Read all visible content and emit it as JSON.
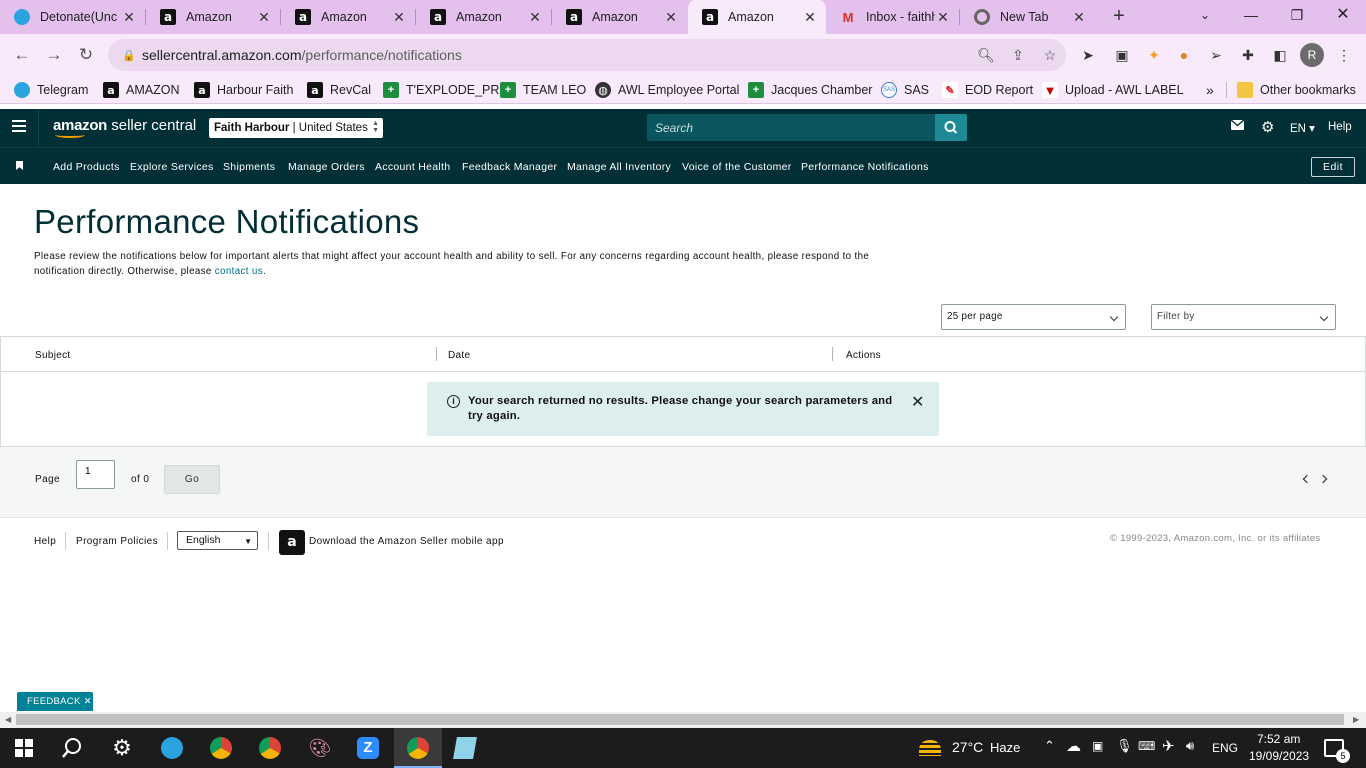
{
  "browser": {
    "tabs": [
      {
        "title": "Detonate(Unc",
        "icon": "telegram-icon"
      },
      {
        "title": "Amazon",
        "icon": "amazon-icon"
      },
      {
        "title": "Amazon",
        "icon": "amazon-icon"
      },
      {
        "title": "Amazon",
        "icon": "amazon-icon"
      },
      {
        "title": "Amazon",
        "icon": "amazon-icon"
      },
      {
        "title": "Amazon",
        "icon": "amazon-icon",
        "active": true
      },
      {
        "title": "Inbox - faithh",
        "icon": "gmail-icon"
      },
      {
        "title": "New Tab",
        "icon": "chrome-icon"
      }
    ],
    "url_domain": "sellercentral.amazon.com",
    "url_path": "/performance/notifications",
    "profile_initial": "R",
    "bookmarks": [
      {
        "label": "Telegram",
        "icon": "telegram-icon"
      },
      {
        "label": "AMAZON",
        "icon": "amazon-icon"
      },
      {
        "label": "Harbour Faith",
        "icon": "amazon-icon"
      },
      {
        "label": "RevCal",
        "icon": "amazon-icon"
      },
      {
        "label": "T'EXPLODE_PR",
        "icon": "plus-icon"
      },
      {
        "label": "TEAM LEO",
        "icon": "plus-icon"
      },
      {
        "label": "AWL Employee Portal",
        "icon": "globe-icon"
      },
      {
        "label": "Jacques Chamber",
        "icon": "plus-icon"
      },
      {
        "label": "SAS",
        "icon": "sas-icon"
      },
      {
        "label": "EOD Report",
        "icon": "eod-icon"
      },
      {
        "label": "Upload - AWL LABEL",
        "icon": "awl-icon"
      }
    ],
    "overflow": "»",
    "other_bookmarks": "Other bookmarks"
  },
  "seller_central": {
    "logo_amazon": "amazon",
    "logo_rest": "seller central",
    "account_name": "Faith Harbour",
    "account_sep": " | ",
    "account_region": "United States",
    "search_placeholder": "Search",
    "language": "EN",
    "help": "Help",
    "nav": [
      "Add Products",
      "Explore Services",
      "Shipments",
      "Manage Orders",
      "Account Health",
      "Feedback Manager",
      "Manage All Inventory",
      "Voice of the Customer",
      "Performance Notifications"
    ],
    "edit": "Edit"
  },
  "main": {
    "title": "Performance Notifications",
    "intro": "Please review the notifications below for important alerts that might affect your account health and ability to sell. For any concerns regarding account health, please respond to the notification directly. Otherwise, please ",
    "intro_link": "contact us",
    "intro_end": ".",
    "per_page": "25 per page",
    "filter": "Filter by",
    "columns": [
      "Subject",
      "Date",
      "Actions"
    ],
    "alert_message": "Your search returned no results. Please change your search parameters and try again.",
    "page_label": "Page",
    "page_value": "1",
    "of_label": "of 0",
    "go": "Go"
  },
  "footer": {
    "help": "Help",
    "policies": "Program Policies",
    "language": "English",
    "app_text": "Download the Amazon Seller mobile app",
    "copyright": "© 1999-2023, Amazon.com, Inc. or its affiliates",
    "feedback": "FEEDBACK"
  },
  "taskbar": {
    "weather_temp": "27°C",
    "weather_desc": "Haze",
    "lang": "ENG",
    "time": "7:52 am",
    "date": "19/09/2023",
    "notifications": "5"
  },
  "colors": {
    "header_bg": "#002f36",
    "link": "#007185",
    "tab_strip": "#e4c1ec",
    "alert_bg": "#ddeeef"
  }
}
